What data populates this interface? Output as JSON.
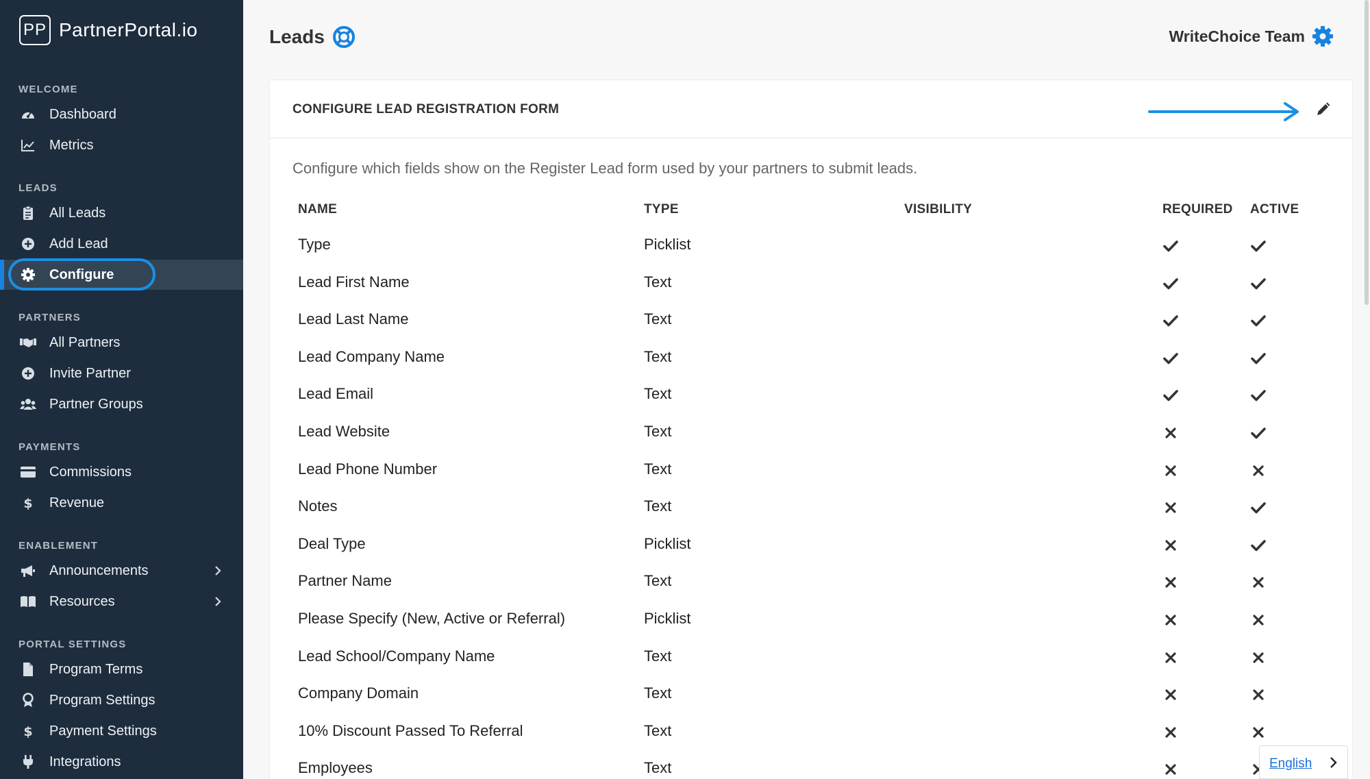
{
  "brand": {
    "logo": "PP",
    "name": "PartnerPortal.io"
  },
  "sidebar": {
    "sections": [
      {
        "title": "WELCOME",
        "items": [
          {
            "label": "Dashboard",
            "icon": "dashboard-icon"
          },
          {
            "label": "Metrics",
            "icon": "chart-icon"
          }
        ]
      },
      {
        "title": "LEADS",
        "items": [
          {
            "label": "All Leads",
            "icon": "clipboard-icon"
          },
          {
            "label": "Add Lead",
            "icon": "plus-circle-icon"
          },
          {
            "label": "Configure",
            "icon": "gear-icon",
            "active": true
          }
        ]
      },
      {
        "title": "PARTNERS",
        "items": [
          {
            "label": "All Partners",
            "icon": "handshake-icon"
          },
          {
            "label": "Invite Partner",
            "icon": "plus-circle-icon"
          },
          {
            "label": "Partner Groups",
            "icon": "users-icon"
          }
        ]
      },
      {
        "title": "PAYMENTS",
        "items": [
          {
            "label": "Commissions",
            "icon": "credit-card-icon"
          },
          {
            "label": "Revenue",
            "icon": "dollar-icon"
          }
        ]
      },
      {
        "title": "ENABLEMENT",
        "items": [
          {
            "label": "Announcements",
            "icon": "megaphone-icon",
            "chevron": true
          },
          {
            "label": "Resources",
            "icon": "book-icon",
            "chevron": true
          }
        ]
      },
      {
        "title": "PORTAL SETTINGS",
        "items": [
          {
            "label": "Program Terms",
            "icon": "file-icon"
          },
          {
            "label": "Program Settings",
            "icon": "award-icon"
          },
          {
            "label": "Payment Settings",
            "icon": "dollar-icon"
          },
          {
            "label": "Integrations",
            "icon": "plug-icon"
          }
        ]
      }
    ]
  },
  "header": {
    "title": "Leads",
    "help_icon": "lifebuoy-icon",
    "team": "WriteChoice Team",
    "team_icon": "gear-icon"
  },
  "card": {
    "title": "CONFIGURE LEAD REGISTRATION FORM",
    "edit_icon": "pencil-icon",
    "description": "Configure which fields show on the Register Lead form used by your partners to submit leads.",
    "columns": {
      "name": "NAME",
      "type": "TYPE",
      "visibility": "VISIBILITY",
      "required": "REQUIRED",
      "active": "ACTIVE"
    },
    "rows": [
      {
        "name": "Type",
        "type": "Picklist",
        "required": true,
        "active": true
      },
      {
        "name": "Lead First Name",
        "type": "Text",
        "required": true,
        "active": true
      },
      {
        "name": "Lead Last Name",
        "type": "Text",
        "required": true,
        "active": true
      },
      {
        "name": "Lead Company Name",
        "type": "Text",
        "required": true,
        "active": true
      },
      {
        "name": "Lead Email",
        "type": "Text",
        "required": true,
        "active": true
      },
      {
        "name": "Lead Website",
        "type": "Text",
        "required": false,
        "active": true
      },
      {
        "name": "Lead Phone Number",
        "type": "Text",
        "required": false,
        "active": false
      },
      {
        "name": "Notes",
        "type": "Text",
        "required": false,
        "active": true
      },
      {
        "name": "Deal Type",
        "type": "Picklist",
        "required": false,
        "active": true
      },
      {
        "name": "Partner Name",
        "type": "Text",
        "required": false,
        "active": false
      },
      {
        "name": "Please Specify (New, Active or Referral)",
        "type": "Picklist",
        "required": false,
        "active": false
      },
      {
        "name": "Lead School/Company Name",
        "type": "Text",
        "required": false,
        "active": false
      },
      {
        "name": "Company Domain",
        "type": "Text",
        "required": false,
        "active": false
      },
      {
        "name": "10% Discount Passed To Referral",
        "type": "Text",
        "required": false,
        "active": false
      },
      {
        "name": "Employees",
        "type": "Text",
        "required": false,
        "active": false
      }
    ]
  },
  "language": {
    "label": "English"
  },
  "colors": {
    "sidebar_bg": "#1e2d3d",
    "accent": "#1683e0",
    "active_bg": "#334455",
    "arrow": "#1a8fe3"
  }
}
